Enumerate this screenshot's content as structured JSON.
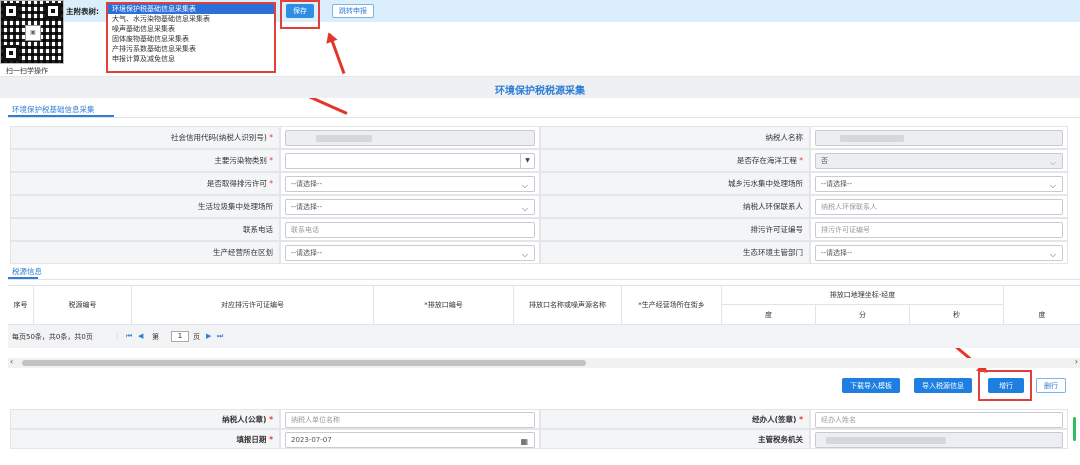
{
  "top": {
    "scan_label": "扫一扫学操作",
    "form_select_label": "主附表树:",
    "form_options": [
      "环境保护税基础信息采集表",
      "大气、水污染物基础信息采集表",
      "噪声基础信息采集表",
      "固体废物基础信息采集表",
      "产排污系数基础信息采集表",
      "申报计算及减免信息"
    ],
    "selected_option_index": 0,
    "save_label": "保存",
    "jump_label": "跳转申报"
  },
  "page_title": "环境保护税税源采集",
  "tabs": {
    "basic": "环境保护税基础信息采集",
    "source": "税源信息"
  },
  "basic_form": {
    "credit_code_label": "社会信用代码(纳税人识别号)",
    "taxpayer_name_label": "纳税人名称",
    "pollutant_type_label": "主要污染物类别",
    "ocean_project_label": "是否存在海洋工程",
    "ocean_project_value": "否",
    "permit_label": "是否取得排污许可",
    "permit_placeholder": "--请选择--",
    "sewage_site_label": "城乡污水集中处理场所",
    "sewage_site_placeholder": "--请选择--",
    "garbage_site_label": "生活垃圾集中处理场所",
    "garbage_site_placeholder": "--请选择--",
    "env_contact_label": "纳税人环保联系人",
    "env_contact_placeholder": "纳税人环保联系人",
    "phone_label": "联系电话",
    "phone_placeholder": "联系电话",
    "permit_no_label": "排污许可证编号",
    "permit_no_placeholder": "排污许可证编号",
    "district_label": "生产经营所在区划",
    "district_placeholder": "--请选择--",
    "eco_dept_label": "生态环境主管部门",
    "eco_dept_placeholder": "--请选择--",
    "required_mark": "*"
  },
  "source_table": {
    "headers": {
      "seq": "序号",
      "source_no": "税源编号",
      "permit_no": "对应排污许可证编号",
      "outlet_no": "*排放口编号",
      "outlet_name": "排放口名称或噪声源名称",
      "street": "*生产经营场所在街乡",
      "geo": "排放口地理坐标-经度",
      "deg": "度",
      "min": "分",
      "sec": "秒",
      "deg2": "度"
    },
    "pager": {
      "summary": "每页50条，共0条，共0页",
      "page_prefix": "第",
      "page_value": "1",
      "page_suffix": "页"
    }
  },
  "actions": {
    "download_template": "下载导入模板",
    "import_source": "导入税源信息",
    "add_row": "增行",
    "delete_row": "删行"
  },
  "signature": {
    "taxpayer_seal_label": "纳税人(公章)",
    "taxpayer_seal_placeholder": "纳税人单位名称",
    "agent_label": "经办人(签章)",
    "agent_placeholder": "经办人姓名",
    "fill_date_label": "填报日期",
    "fill_date_value": "2023-07-07",
    "tax_authority_label": "主管税务机关"
  },
  "colors": {
    "accent": "#2f7dd6",
    "annotation_red": "#e5352b",
    "selected_option": "#2d6fd8"
  }
}
